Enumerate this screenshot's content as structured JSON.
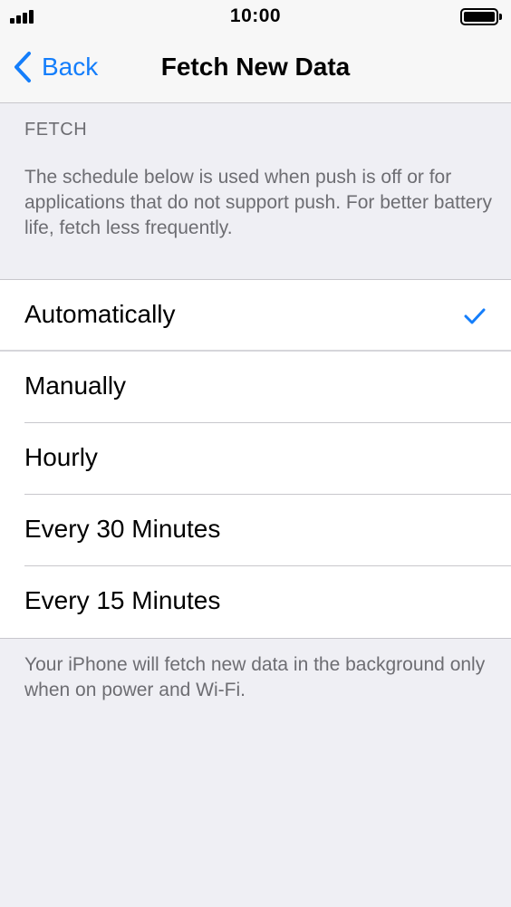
{
  "status_bar": {
    "time": "10:00",
    "signal_icon": "cellular-signal-icon",
    "battery_icon": "battery-full-icon"
  },
  "nav": {
    "back_label": "Back",
    "back_icon": "chevron-left-icon",
    "title": "Fetch New Data"
  },
  "section": {
    "header": "FETCH",
    "description": "The schedule below is used when push is off or for applications that do not support push. For better battery life, fetch less frequently."
  },
  "options": [
    {
      "label": "Automatically",
      "selected": true
    },
    {
      "label": "Manually",
      "selected": false
    },
    {
      "label": "Hourly",
      "selected": false
    },
    {
      "label": "Every 30 Minutes",
      "selected": false
    },
    {
      "label": "Every 15 Minutes",
      "selected": false
    }
  ],
  "footer": {
    "note": "Your iPhone will fetch new data in the background only when on power and Wi-Fi."
  },
  "colors": {
    "accent": "#147efb",
    "background": "#efeff4",
    "secondary_text": "#6d6d72"
  }
}
